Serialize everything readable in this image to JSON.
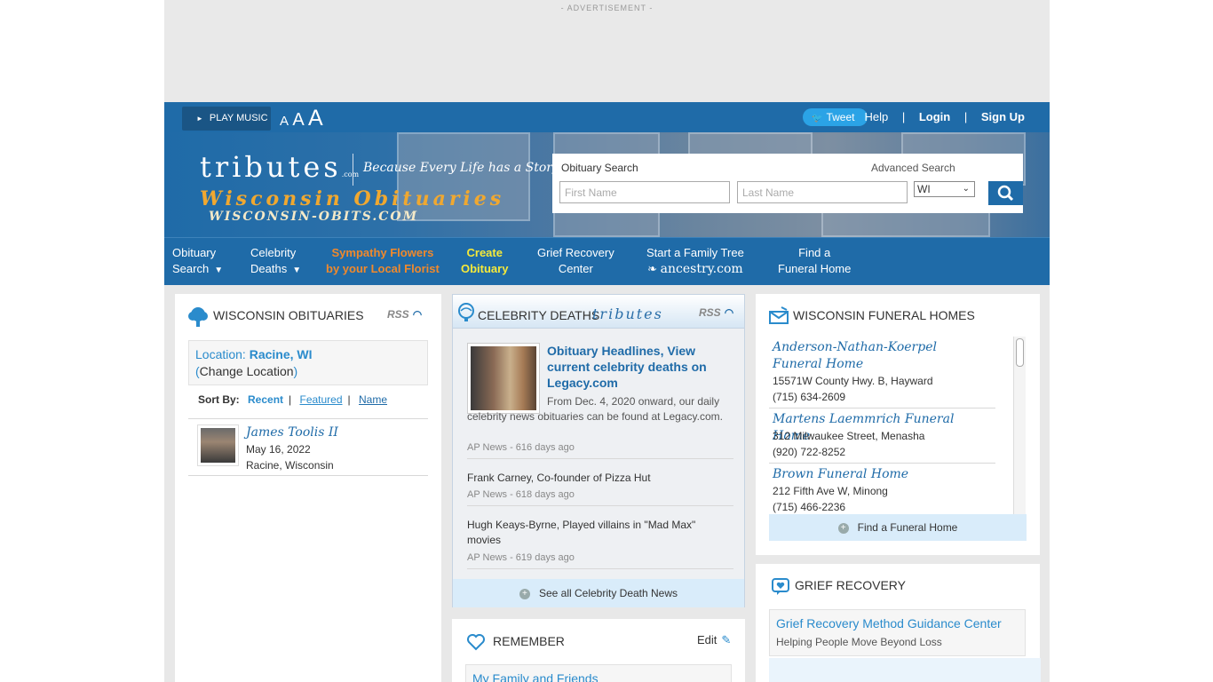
{
  "advertisement": {
    "label": "- ADVERTISEMENT -"
  },
  "topbar": {
    "play_music": "PLAY MUSIC",
    "font_sizes": [
      "A",
      "A",
      "A"
    ],
    "tweet": "Tweet",
    "links": {
      "help": "Help",
      "login": "Login",
      "signup": "Sign Up"
    }
  },
  "brand": {
    "logo": "tributes",
    "logo_suffix": ".com",
    "tagline": "Because Every Life has a Story",
    "state_title": "Wisconsin Obituaries",
    "domain": "WISCONSIN-OBITS.COM"
  },
  "search": {
    "label": "Obituary Search",
    "advanced": "Advanced Search",
    "first_placeholder": "First Name",
    "last_placeholder": "Last Name",
    "state_value": "WI"
  },
  "nav": [
    {
      "line1": "Obituary",
      "line2": "Search"
    },
    {
      "line1": "Celebrity",
      "line2": "Deaths"
    },
    {
      "line1": "Sympathy Flowers",
      "line2": "by your Local Florist"
    },
    {
      "line1": "Create",
      "line2": "Obituary"
    },
    {
      "line1": "Grief Recovery",
      "line2": "Center"
    },
    {
      "line1": "Start a Family Tree",
      "line2": "ancestry.com"
    },
    {
      "line1": "Find a",
      "line2": "Funeral Home"
    }
  ],
  "obituaries": {
    "title": "WISCONSIN OBITUARIES",
    "rss": "RSS",
    "location_label": "Location: ",
    "location_value": "Racine, WI",
    "change_location": "Change Location",
    "sort_label": "Sort By:",
    "sort_options": [
      "Recent",
      "Featured",
      "Name"
    ],
    "entries": [
      {
        "name": "James Toolis II",
        "date": "May 16, 2022",
        "place": "Racine, Wisconsin"
      }
    ]
  },
  "celebrity": {
    "title": "CELEBRITY DEATHS",
    "brand": "tributes",
    "rss": "RSS",
    "featured": {
      "headline": "Obituary Headlines, View current celebrity deaths on Legacy.com",
      "description": "From Dec. 4, 2020 onward, our daily celebrity news obituaries can be found at Legacy.com.",
      "source": "AP News - 616 days ago"
    },
    "items": [
      {
        "text": "Frank Carney, Co-founder of Pizza Hut",
        "source": "AP News - 618 days ago"
      },
      {
        "text": "Hugh Keays-Byrne, Played villains in \"Mad Max\" movies",
        "source": "AP News - 619 days ago"
      }
    ],
    "see_all": "See all Celebrity Death News"
  },
  "remember": {
    "title": "REMEMBER",
    "edit": "Edit",
    "section": "My Family and Friends"
  },
  "funeral_homes": {
    "title": "WISCONSIN FUNERAL HOMES",
    "items": [
      {
        "name": "Anderson-Nathan-Koerpel Funeral Home",
        "address": "15571W County Hwy. B, Hayward",
        "phone": "(715) 634-2609"
      },
      {
        "name": "Martens Laemmrich Funeral Home",
        "address": "312 Milwaukee Street, Menasha",
        "phone": "(920) 722-8252"
      },
      {
        "name": "Brown Funeral Home",
        "address": "212 Fifth Ave W, Minong",
        "phone": "(715) 466-2236"
      }
    ],
    "find": "Find a Funeral Home"
  },
  "grief": {
    "title": "GRIEF RECOVERY",
    "center_title": "Grief Recovery Method Guidance Center",
    "center_sub": "Helping People Move Beyond Loss"
  },
  "colors": {
    "brand_blue": "#1f6ba8",
    "link_blue": "#2a8bcc",
    "accent_orange": "#f0892c",
    "accent_yellow": "#f6e93a"
  }
}
